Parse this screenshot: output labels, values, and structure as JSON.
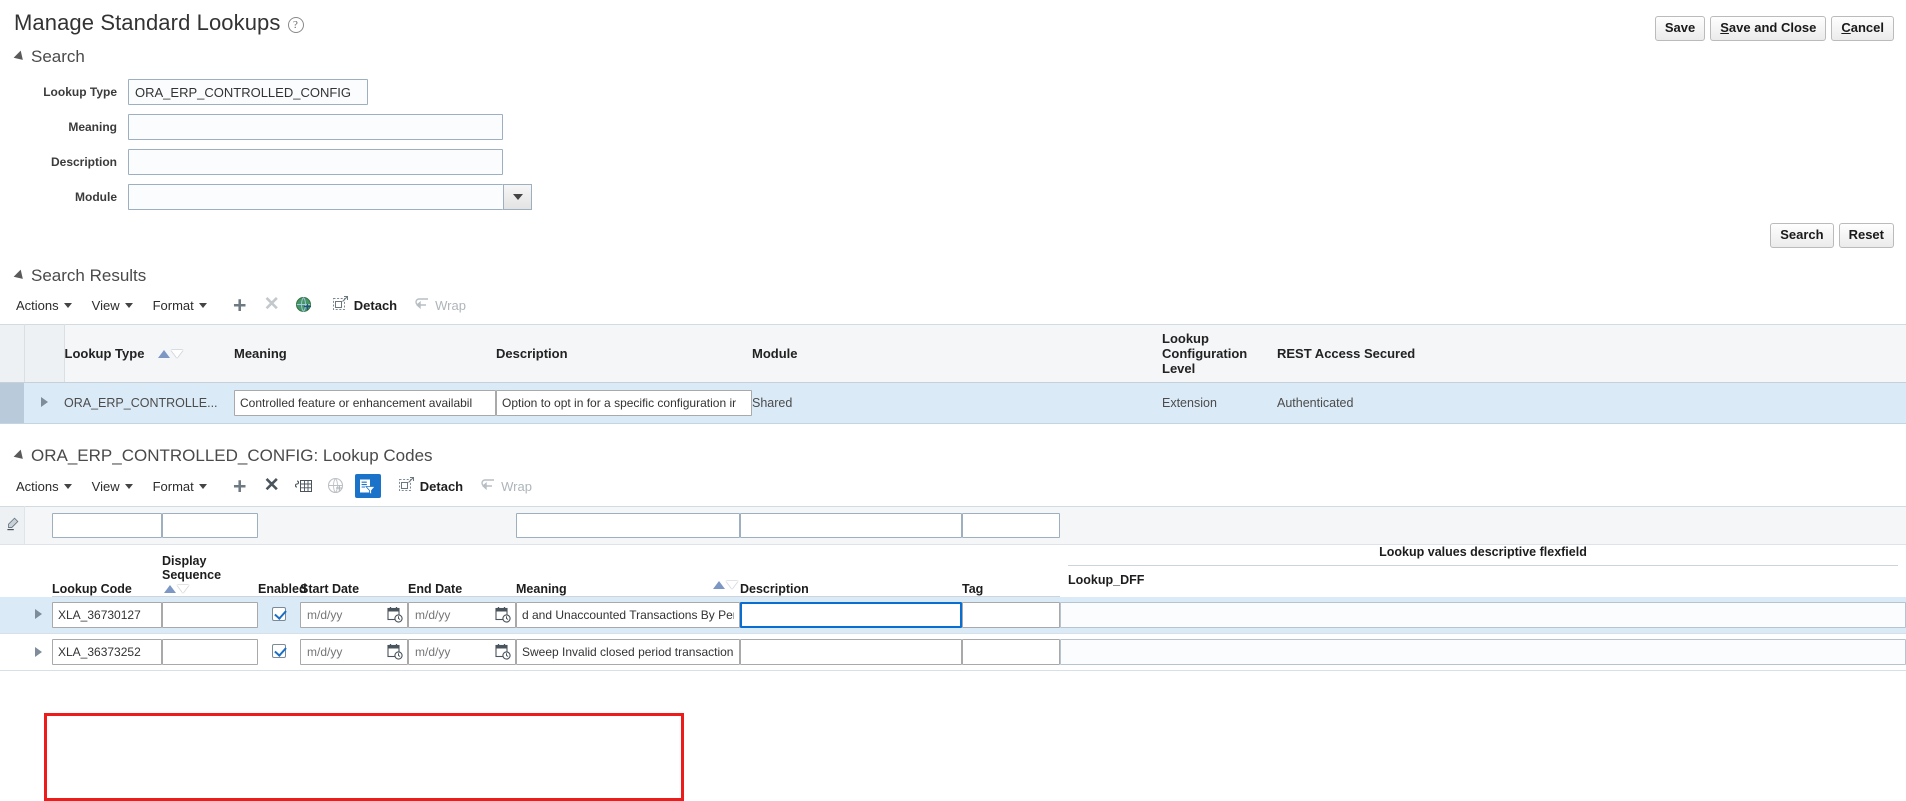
{
  "header": {
    "title": "Manage Standard Lookups",
    "help_icon": "question-circle-icon",
    "buttons": [
      {
        "label": "Save",
        "accesskey": ""
      },
      {
        "label": "Save and Close",
        "accesskey": "S"
      },
      {
        "label": "Cancel",
        "accesskey": "C"
      }
    ]
  },
  "search": {
    "section_title": "Search",
    "fields": [
      {
        "label": "Lookup Type",
        "value": "ORA_ERP_CONTROLLED_CONFIG",
        "placeholder": ""
      },
      {
        "label": "Meaning",
        "value": "",
        "placeholder": ""
      },
      {
        "label": "Description",
        "value": "",
        "placeholder": ""
      },
      {
        "label": "Module",
        "value": "",
        "placeholder": ""
      }
    ],
    "search_button": "Search",
    "reset_button": "Reset"
  },
  "results": {
    "section_title": "Search Results",
    "toolbar": {
      "actions": "Actions",
      "view": "View",
      "format": "Format",
      "add_icon": "plus-icon",
      "delete_icon": "close-x-icon",
      "translation_icon": "globe-icon",
      "detach": "Detach",
      "detach_icon": "detach-icon",
      "wrap": "Wrap",
      "wrap_icon": "wrap-icon"
    },
    "columns": [
      "Lookup Type",
      "Meaning",
      "Description",
      "Module",
      "Lookup Configuration Level",
      "REST Access Secured"
    ],
    "rows": [
      {
        "lookup_type": "ORA_ERP_CONTROLLE...",
        "meaning": "Controlled feature or enhancement availabil",
        "description": "Option to opt in for a specific configuration ir",
        "module": "Shared",
        "config_level": "Extension",
        "rest_access": "Authenticated"
      }
    ]
  },
  "lookup_codes": {
    "section_title": "ORA_ERP_CONTROLLED_CONFIG: Lookup Codes",
    "toolbar": {
      "actions": "Actions",
      "view": "View",
      "format": "Format",
      "add_icon": "plus-icon",
      "delete_icon": "close-x-icon",
      "freeze_icon": "freeze-columns-icon",
      "translation_icon": "globe-icon",
      "query_by_example_icon": "query-by-example-icon",
      "detach": "Detach",
      "detach_icon": "detach-icon",
      "wrap": "Wrap",
      "wrap_icon": "wrap-icon"
    },
    "filter_row": {
      "clear_icon": "clear-filter-icon",
      "lookup_code": "",
      "display_sequence": "",
      "meaning": "",
      "description": "",
      "tag": ""
    },
    "columns": {
      "lookup_code": "Lookup Code",
      "display_sequence": "Display Sequence",
      "enabled": "Enabled",
      "start_date": "Start Date",
      "end_date": "End Date",
      "meaning": "Meaning",
      "description": "Description",
      "tag": "Tag",
      "dff_group": "Lookup values descriptive flexfield",
      "dff_column": "Lookup_DFF"
    },
    "date_placeholder": "m/d/yy",
    "rows": [
      {
        "lookup_code": "XLA_36730127",
        "display_sequence": "",
        "enabled": true,
        "start_date": "",
        "end_date": "",
        "meaning": "d and Unaccounted Transactions By Period",
        "description": "",
        "tag": "",
        "lookup_dff": "",
        "selected": true,
        "description_focused": true
      },
      {
        "lookup_code": "XLA_36373252",
        "display_sequence": "",
        "enabled": true,
        "start_date": "",
        "end_date": "",
        "meaning": "Sweep Invalid closed period transactions",
        "description": "",
        "tag": "",
        "lookup_dff": "",
        "selected": false,
        "description_focused": false
      }
    ]
  },
  "annotation": {
    "highlight_color": "#ee1b1b"
  }
}
